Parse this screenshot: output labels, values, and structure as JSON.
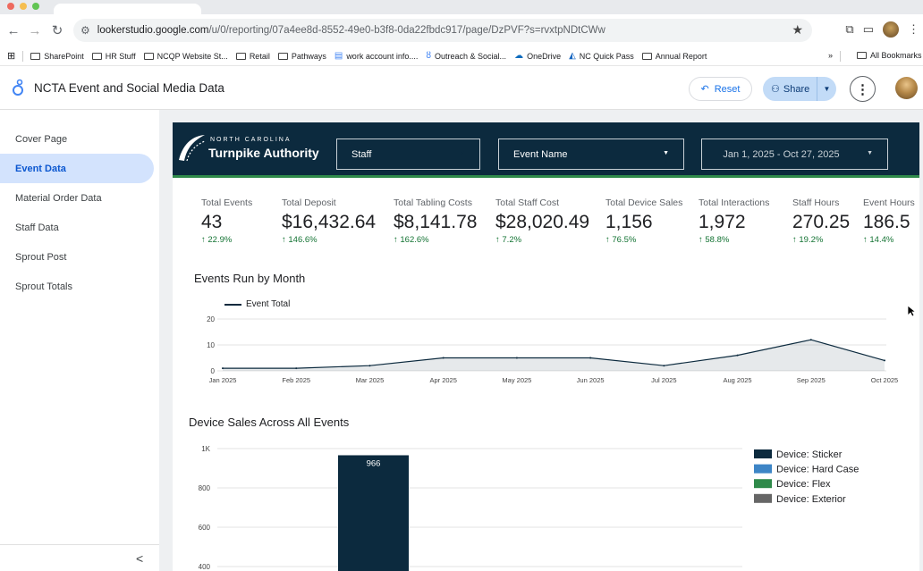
{
  "browser": {
    "url_host": "lookerstudio.google.com",
    "url_path": "/u/0/reporting/07a4ee8d-8552-49e0-b3f8-0da22fbdc917/page/DzPVF?s=rvxtpNDtCWw",
    "bookmarks": [
      "SharePoint",
      "HR Stuff",
      "NCQP Website St...",
      "Retail",
      "Pathways",
      "work account info....",
      "Outreach & Social...",
      "OneDrive",
      "NC Quick Pass",
      "Annual Report"
    ],
    "more_chevron": "»",
    "all_bookmarks": "All Bookmarks"
  },
  "app": {
    "title": "NCTA Event and Social Media Data",
    "reset_label": "Reset",
    "share_label": "Share"
  },
  "sidebar": {
    "items": [
      {
        "label": "Cover Page",
        "active": false
      },
      {
        "label": "Event Data",
        "active": true
      },
      {
        "label": "Material Order Data",
        "active": false
      },
      {
        "label": "Staff Data",
        "active": false
      },
      {
        "label": "Sprout Post",
        "active": false
      },
      {
        "label": "Sprout Totals",
        "active": false
      }
    ],
    "collapse_glyph": "<"
  },
  "banner": {
    "brand_top": "NORTH CAROLINA",
    "brand_main": "Turnpike Authority",
    "filters": {
      "staff": "Staff",
      "event_name": "Event Name",
      "date_range": "Jan 1, 2025 - Oct 27, 2025"
    }
  },
  "kpis": [
    {
      "label": "Total Events",
      "value": "43",
      "delta": "22.9%"
    },
    {
      "label": "Total Deposit",
      "value": "$16,432.64",
      "delta": "146.6%"
    },
    {
      "label": "Total Tabling Costs",
      "value": "$8,141.78",
      "delta": "162.6%"
    },
    {
      "label": "Total Staff Cost",
      "value": "$28,020.49",
      "delta": "7.2%"
    },
    {
      "label": "Total Device Sales",
      "value": "1,156",
      "delta": "76.5%"
    },
    {
      "label": "Total Interactions",
      "value": "1,972",
      "delta": "58.8%"
    },
    {
      "label": "Staff Hours",
      "value": "270.25",
      "delta": "19.2%"
    },
    {
      "label": "Event Hours",
      "value": "186.5",
      "delta": "14.4%"
    }
  ],
  "delta_arrow": "↑",
  "colors": {
    "navy": "#0c2a3e",
    "accent_green": "#2f8a4a",
    "delta_green": "#137333",
    "sidebar_active": "#d3e3fd"
  },
  "chart_data": [
    {
      "type": "area",
      "title": "Events Run by Month",
      "series": [
        {
          "name": "Event Total",
          "values": [
            1,
            1,
            2,
            5,
            5,
            5,
            2,
            6,
            12,
            4
          ]
        }
      ],
      "categories": [
        "Jan 2025",
        "Feb 2025",
        "Mar 2025",
        "Apr 2025",
        "May 2025",
        "Jun 2025",
        "Jul 2025",
        "Aug 2025",
        "Sep 2025",
        "Oct 2025"
      ],
      "yticks": [
        "0",
        "10",
        "20"
      ],
      "ylim": [
        0,
        20
      ],
      "grid": true,
      "legend": "top-left",
      "color": "#0c2a3e"
    },
    {
      "type": "bar",
      "title": "Device Sales Across All Events",
      "categories": [
        ""
      ],
      "series": [
        {
          "name": "Device: Sticker",
          "values": [
            966
          ],
          "color": "#0c2a3e"
        },
        {
          "name": "Device: Hard Case",
          "values": [
            null
          ],
          "color": "#3d85c6"
        },
        {
          "name": "Device: Flex",
          "values": [
            null
          ],
          "color": "#2f8a4a"
        },
        {
          "name": "Device: Exterior",
          "values": [
            null
          ],
          "color": "#666666"
        }
      ],
      "data_labels": [
        "966"
      ],
      "yticks": [
        "1K",
        "800",
        "600",
        "400"
      ],
      "ylim": [
        0,
        1000
      ],
      "grid": true,
      "legend": "right"
    }
  ]
}
